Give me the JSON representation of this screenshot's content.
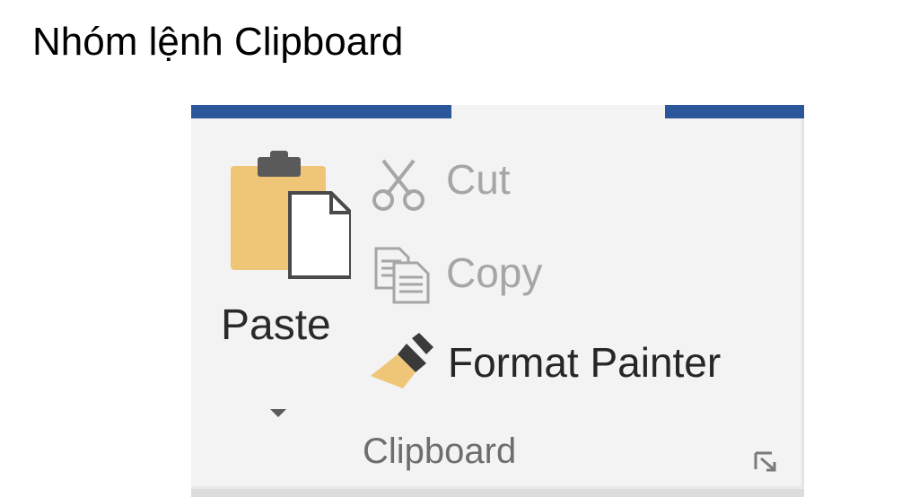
{
  "slide": {
    "title": "Nhóm lệnh Clipboard"
  },
  "ribbon": {
    "group_label": "Clipboard",
    "paste": {
      "label": "Paste"
    },
    "cut": {
      "label": "Cut",
      "state": "disabled"
    },
    "copy": {
      "label": "Copy",
      "state": "disabled"
    },
    "format_painter": {
      "label": "Format Painter",
      "state": "enabled"
    }
  },
  "colors": {
    "tab_accent": "#2b579a",
    "ribbon_bg": "#f3f3f3",
    "clipboard_board": "#efc677",
    "disabled_text": "#a6a6a6",
    "enabled_text": "#262626",
    "brush_bristles": "#efc677"
  }
}
